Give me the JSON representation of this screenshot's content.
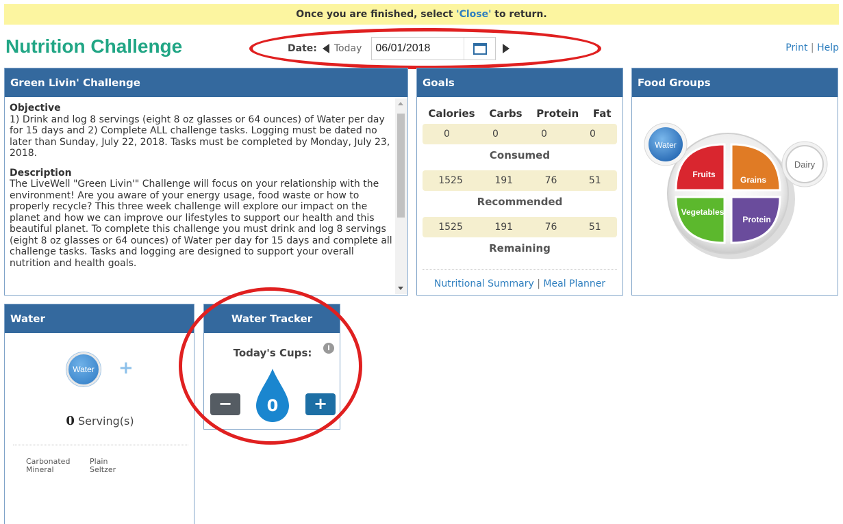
{
  "banner": {
    "prefix": "Once you are finished, select ",
    "close_link": "'Close'",
    "suffix": " to return."
  },
  "app": {
    "title": "Nutrition Challenge"
  },
  "datebar": {
    "label": "Date:",
    "today": "Today",
    "date_value": "06/01/2018"
  },
  "toplinks": {
    "print": "Print",
    "sep": "|",
    "help": "Help"
  },
  "challenge": {
    "title": "Green Livin' Challenge",
    "objective_heading": "Objective",
    "objective_text": "1) Drink and log 8 servings (eight 8 oz glasses or 64 ounces) of Water per day for 15 days and 2) Complete ALL challenge tasks. Logging must be dated no later than Sunday, July 22, 2018. Tasks must be completed by Monday, July 23, 2018.",
    "description_heading": "Description",
    "description_text": "The LiveWell \"Green Livin'\" Challenge will focus on your relationship with the environment! Are you aware of your energy usage, food waste or how to properly recycle? This three week challenge will explore our impact on the planet and how we can improve our lifestyles to support our health and this beautiful planet. To complete this challenge you must drink and log 8 servings (eight 8 oz glasses or 64 ounces) of Water per day for 15 days and complete all challenge tasks. Tasks and logging are designed to support your overall nutrition and health goals."
  },
  "goals": {
    "title": "Goals",
    "columns": [
      "Calories",
      "Carbs",
      "Protein",
      "Fat"
    ],
    "consumed": {
      "values": [
        "0",
        "0",
        "0",
        "0"
      ],
      "label": "Consumed"
    },
    "recommended": {
      "values": [
        "1525",
        "191",
        "76",
        "51"
      ],
      "label": "Recommended"
    },
    "remaining": {
      "values": [
        "1525",
        "191",
        "76",
        "51"
      ],
      "label": "Remaining"
    },
    "links": {
      "summary": "Nutritional Summary",
      "sep": "|",
      "planner": "Meal Planner"
    }
  },
  "food_groups": {
    "title": "Food Groups",
    "water": "Water",
    "dairy": "Dairy",
    "fruits": "Fruits",
    "grains": "Grains",
    "vegetables": "Vegetables",
    "protein": "Protein",
    "colors": {
      "fruits": "#d9262f",
      "grains": "#e07b25",
      "vegetables": "#5cb82d",
      "protein": "#6a4c9c",
      "water": "#2d7ac4"
    }
  },
  "water": {
    "title": "Water",
    "circle_label": "Water",
    "serving_count": "0",
    "serving_unit": "Serving(s)",
    "options": [
      {
        "line1": "Carbonated",
        "line2": "Mineral"
      },
      {
        "line1": "Plain",
        "line2": "Seltzer"
      }
    ]
  },
  "tracker": {
    "title": "Water Tracker",
    "todays_cups": "Today's Cups:",
    "info": "i",
    "count": "0",
    "minus": "−",
    "plus": "+"
  }
}
